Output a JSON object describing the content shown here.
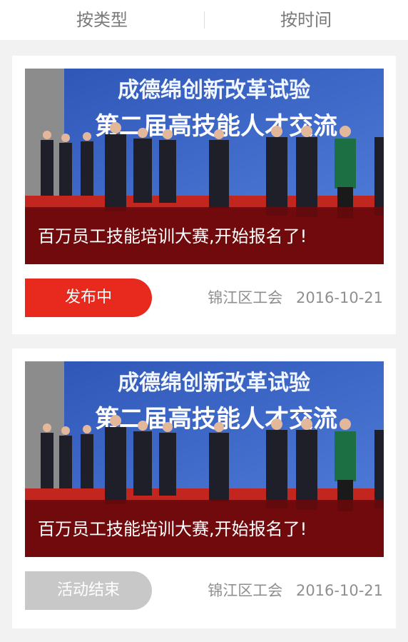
{
  "tabs": [
    {
      "label": "按类型"
    },
    {
      "label": "按时间"
    }
  ],
  "cards": [
    {
      "banner_line1": "成德绵创新改革试验",
      "banner_line2": "第二届高技能人才交流",
      "title": "百万员工技能培训大赛,开始报名了!",
      "status": "发布中",
      "organizer": "锦江区工会",
      "date": "2016-10-21"
    },
    {
      "banner_line1": "成德绵创新改革试验",
      "banner_line2": "第二届高技能人才交流",
      "title": "百万员工技能培训大赛,开始报名了!",
      "status": "活动结束",
      "organizer": "锦江区工会",
      "date": "2016-10-21"
    }
  ],
  "colors": {
    "active_status": "#e8291d",
    "ended_status": "#c8c8c8",
    "caption_band": "#6e080a"
  }
}
